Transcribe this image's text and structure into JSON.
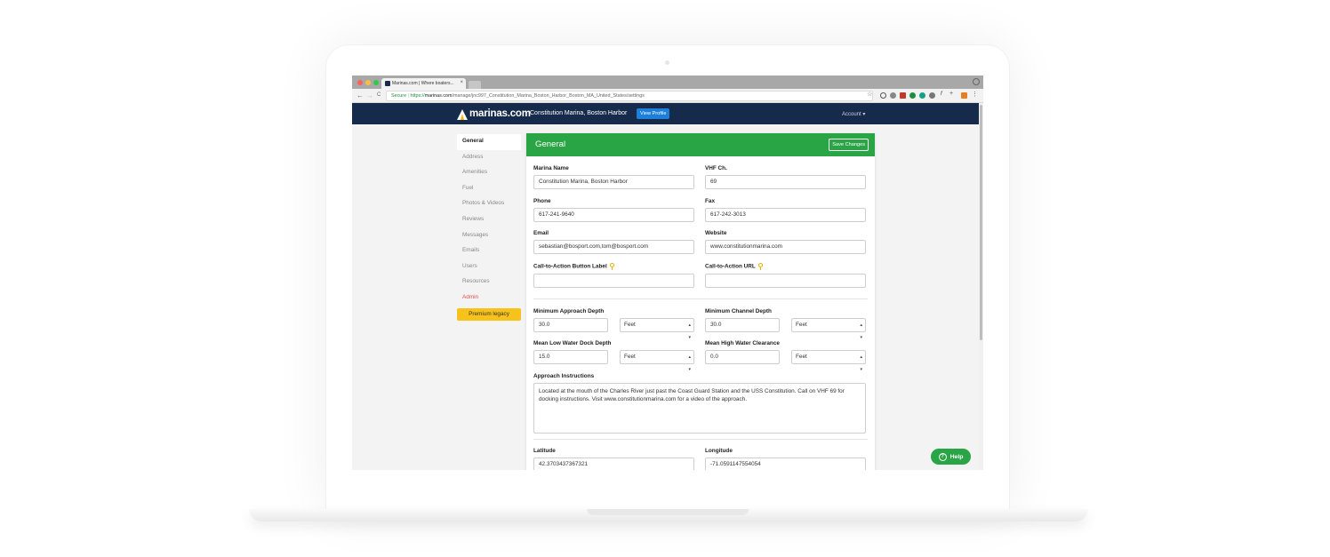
{
  "browser": {
    "tab_title": "Marinas.com | Where boaters...",
    "tab_close": "×",
    "url_secure_label": "Secure",
    "url_scheme": "https://",
    "url_host": "marinas.com",
    "url_path": "/manage/jnc997_Constitution_Marina_Boston_Harbor_Boston_MA_United_States/settings",
    "nav_back": "←",
    "nav_forward": "→",
    "nav_reload": "C",
    "bookmark_star": "☆"
  },
  "site_nav": {
    "brand": "marinas.com",
    "marina_name": "Constitution Marina, Boston Harbor",
    "view_profile": "View Profile",
    "account": "Account ▾"
  },
  "sidebar": {
    "items": [
      {
        "label": "General"
      },
      {
        "label": "Address"
      },
      {
        "label": "Amenities"
      },
      {
        "label": "Fuel"
      },
      {
        "label": "Photos & Videos"
      },
      {
        "label": "Reviews"
      },
      {
        "label": "Messages"
      },
      {
        "label": "Emails"
      },
      {
        "label": "Users"
      },
      {
        "label": "Resources"
      },
      {
        "label": "Admin"
      }
    ],
    "premium": "Premium legacy"
  },
  "form": {
    "title": "General",
    "save_label": "Save Changes",
    "marina_name_label": "Marina Name",
    "marina_name_value": "Constitution Marina, Boston Harbor",
    "vhf_label": "VHF Ch.",
    "vhf_value": "69",
    "phone_label": "Phone",
    "phone_value": "617-241-9640",
    "fax_label": "Fax",
    "fax_value": "617-242-3013",
    "email_label": "Email",
    "email_value": "sebastian@bosport.com,tom@bosport.com",
    "website_label": "Website",
    "website_value": "www.constitutionmarina.com",
    "cta_button_label": "Call-to-Action Button Label",
    "cta_button_value": "",
    "cta_url_label": "Call-to-Action URL",
    "cta_url_value": "",
    "min_approach_label": "Minimum Approach Depth",
    "min_approach_value": "30.0",
    "min_approach_unit": "Feet",
    "min_channel_label": "Minimum Channel Depth",
    "min_channel_value": "30.0",
    "min_channel_unit": "Feet",
    "mlw_dock_label": "Mean Low Water Dock Depth",
    "mlw_dock_value": "15.0",
    "mlw_dock_unit": "Feet",
    "mhw_clearance_label": "Mean High Water Clearance",
    "mhw_clearance_value": "0.0",
    "mhw_clearance_unit": "Feet",
    "approach_label": "Approach Instructions",
    "approach_value": "Located at the mouth of the Charles River just past the Coast Guard Station and the USS Constitution.  Call on VHF 69 for docking instructions.  Visit www.constitutionmarina.com for a video of the approach.",
    "latitude_label": "Latitude",
    "latitude_value": "42.3703437367321",
    "longitude_label": "Longitude",
    "longitude_value": "-71.0591147554054"
  },
  "help": {
    "label": "Help",
    "icon": "?"
  },
  "colors": {
    "nav_bg": "#162a4b",
    "header_green": "#2aa545",
    "view_profile_blue": "#1e7fd8",
    "premium_yellow": "#f7c21a",
    "admin_red": "#d9534f"
  }
}
